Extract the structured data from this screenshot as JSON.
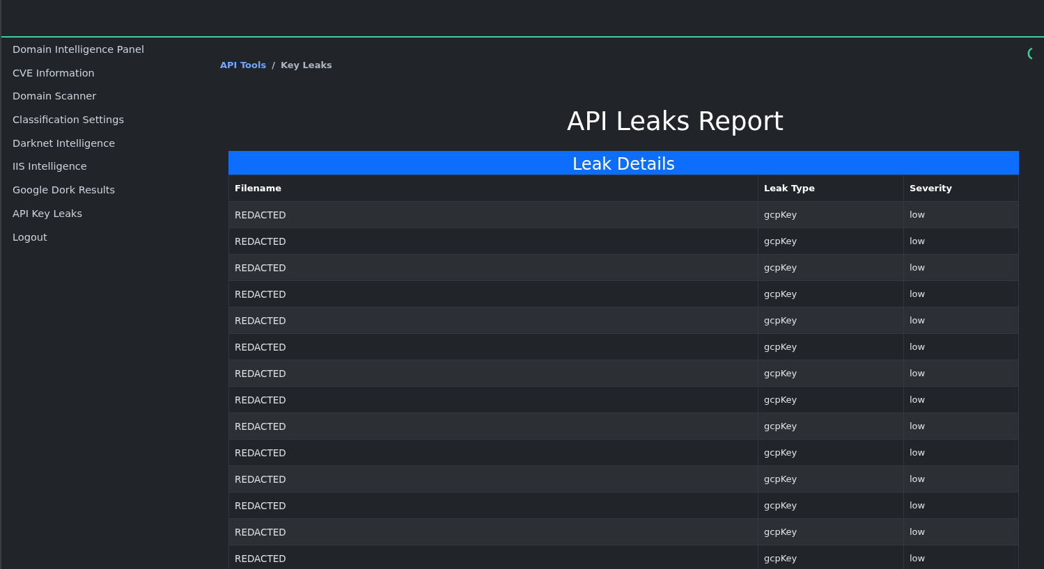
{
  "sidebar": {
    "items": [
      {
        "label": "Domain Intelligence Panel"
      },
      {
        "label": "CVE Information"
      },
      {
        "label": "Domain Scanner"
      },
      {
        "label": "Classification Settings"
      },
      {
        "label": "Darknet Intelligence"
      },
      {
        "label": "IIS Intelligence"
      },
      {
        "label": "Google Dork Results"
      },
      {
        "label": "API Key Leaks"
      },
      {
        "label": "Logout"
      }
    ]
  },
  "breadcrumb": [
    {
      "label": "API Tools",
      "kind": "link"
    },
    {
      "label": "Key Leaks",
      "kind": "current"
    }
  ],
  "breadcrumb_separator": "/",
  "title": "API Leaks Report",
  "table": {
    "caption": "Leak Details",
    "columns": [
      "Filename",
      "Leak Type",
      "Severity"
    ],
    "rows": [
      [
        "REDACTED",
        "gcpKey",
        "low"
      ],
      [
        "REDACTED",
        "gcpKey",
        "low"
      ],
      [
        "REDACTED",
        "gcpKey",
        "low"
      ],
      [
        "REDACTED",
        "gcpKey",
        "low"
      ],
      [
        "REDACTED",
        "gcpKey",
        "low"
      ],
      [
        "REDACTED",
        "gcpKey",
        "low"
      ],
      [
        "REDACTED",
        "gcpKey",
        "low"
      ],
      [
        "REDACTED",
        "gcpKey",
        "low"
      ],
      [
        "REDACTED",
        "gcpKey",
        "low"
      ],
      [
        "REDACTED",
        "gcpKey",
        "low"
      ],
      [
        "REDACTED",
        "gcpKey",
        "low"
      ],
      [
        "REDACTED",
        "gcpKey",
        "low"
      ],
      [
        "REDACTED",
        "gcpKey",
        "low"
      ],
      [
        "REDACTED",
        "gcpKey",
        "low"
      ]
    ]
  }
}
